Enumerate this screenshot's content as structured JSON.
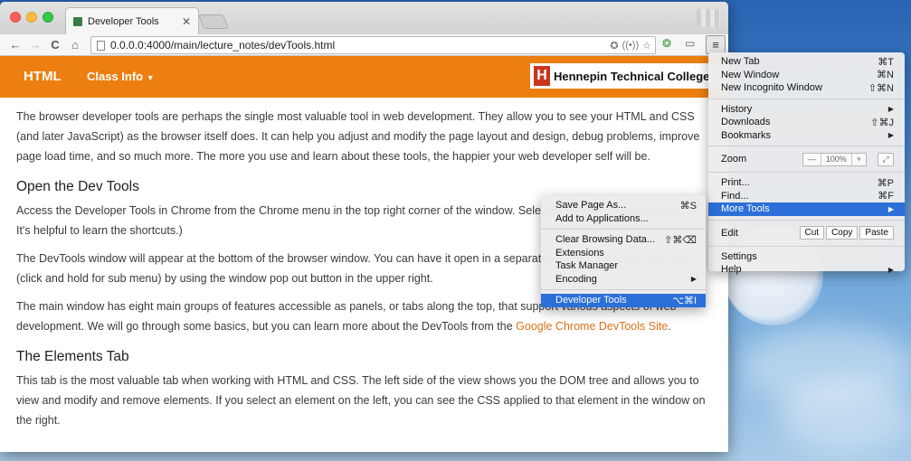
{
  "browser": {
    "tab": {
      "title": "Developer Tools",
      "close": "✕"
    },
    "nav": {
      "back": "←",
      "forward": "→",
      "reload": "C",
      "home": "⌂"
    },
    "url": "0.0.0.0:4000/main/lecture_notes/devTools.html",
    "menu_button": "≡"
  },
  "site": {
    "brand": "HTML",
    "nav_item": "Class Info",
    "logo_mark": "H",
    "logo_text": "Hennepin Technical College"
  },
  "content": {
    "intro": "The browser developer tools are perhaps the single most valuable tool in web development. They allow you to see your HTML and CSS (and later JavaScript) as the browser itself does. It can help you adjust and modify the page layout and design, debug problems, improve page load time, and so much more. The more you use and learn about these tools, the happier your web developer self will be.",
    "h_open": "Open the Dev Tools",
    "p_open": "Access the Developer Tools in Chrome from the Chrome menu in the top right corner of the window. Select More Tools > Developer Tools. It's helpful to learn the shortcuts.)",
    "p_window": "The DevTools window will appear at the bottom of the browser window. You can have it open in a separate window or dock it to the side (click and hold for sub menu) by using the window pop out button in the upper right.",
    "p_main_1": "The main window has eight main groups of features accessible as panels, or tabs along the top, that support various aspects of web development. We will go through some basics, but you can learn more about the DevTools from the ",
    "p_main_link": "Google Chrome DevTools Site",
    "p_main_2": ".",
    "h_elements": "The Elements Tab",
    "p_elements": "This tab is the most valuable tab when working with HTML and CSS. The left side of the view shows you the DOM tree and allows you to view and modify and remove elements. If you select an element on the left, you can see the CSS applied to that element in the window on the right."
  },
  "main_menu": {
    "new_tab": {
      "label": "New Tab",
      "shortcut": "⌘T"
    },
    "new_window": {
      "label": "New Window",
      "shortcut": "⌘N"
    },
    "new_incognito": {
      "label": "New Incognito Window",
      "shortcut": "⇧⌘N"
    },
    "history": {
      "label": "History",
      "arrow": "▶"
    },
    "downloads": {
      "label": "Downloads",
      "shortcut": "⇧⌘J"
    },
    "bookmarks": {
      "label": "Bookmarks",
      "arrow": "▶"
    },
    "zoom": {
      "label": "Zoom",
      "minus": "—",
      "value": "100%",
      "plus": "+",
      "fullscreen": "⤢"
    },
    "print": {
      "label": "Print...",
      "shortcut": "⌘P"
    },
    "find": {
      "label": "Find...",
      "shortcut": "⌘F"
    },
    "more_tools": {
      "label": "More Tools",
      "arrow": "▶"
    },
    "edit": {
      "label": "Edit",
      "cut": "Cut",
      "copy": "Copy",
      "paste": "Paste"
    },
    "settings": {
      "label": "Settings"
    },
    "help": {
      "label": "Help",
      "arrow": "▶"
    }
  },
  "sub_menu": {
    "save_page": {
      "label": "Save Page As...",
      "shortcut": "⌘S"
    },
    "add_apps": {
      "label": "Add to Applications..."
    },
    "clear_data": {
      "label": "Clear Browsing Data...",
      "shortcut": "⇧⌘⌫"
    },
    "extensions": {
      "label": "Extensions"
    },
    "task_manager": {
      "label": "Task Manager"
    },
    "encoding": {
      "label": "Encoding",
      "arrow": "▶"
    },
    "dev_tools": {
      "label": "Developer Tools",
      "shortcut": "⌥⌘I"
    }
  },
  "colors": {
    "navbar": "#ec7f10",
    "highlight": "#2c6fd8",
    "link": "#e07015"
  }
}
